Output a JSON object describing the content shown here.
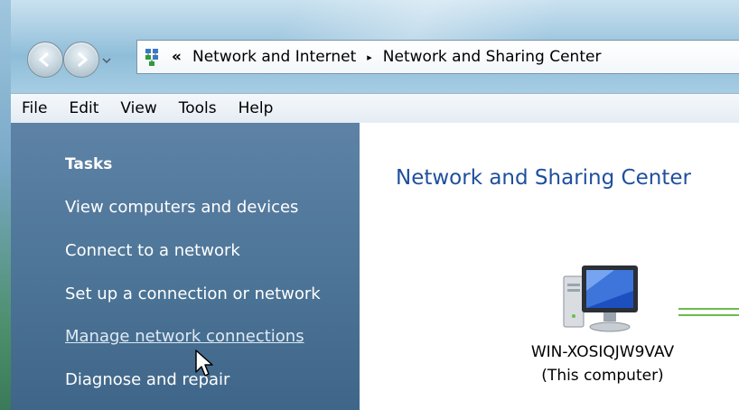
{
  "address_bar": {
    "overflow_chevron": "«",
    "crumbs": [
      "Network and Internet",
      "Network and Sharing Center"
    ],
    "separator": "▸"
  },
  "menu": [
    "File",
    "Edit",
    "View",
    "Tools",
    "Help"
  ],
  "tasks": {
    "heading": "Tasks",
    "items": [
      "View computers and devices",
      "Connect to a network",
      "Set up a connection or network",
      "Manage network connections",
      "Diagnose and repair"
    ]
  },
  "content": {
    "title": "Network and Sharing Center",
    "computer_name": "WIN-XOSIQJW9VAV",
    "computer_label": "(This computer)"
  },
  "colors": {
    "task_pane": "#4f7799",
    "title_blue": "#1f4f9e",
    "network_line": "#6cbb4e"
  },
  "icons": [
    "back-arrow-icon",
    "forward-arrow-icon",
    "network-folder-icon",
    "computer-icon",
    "mouse-cursor-icon"
  ]
}
